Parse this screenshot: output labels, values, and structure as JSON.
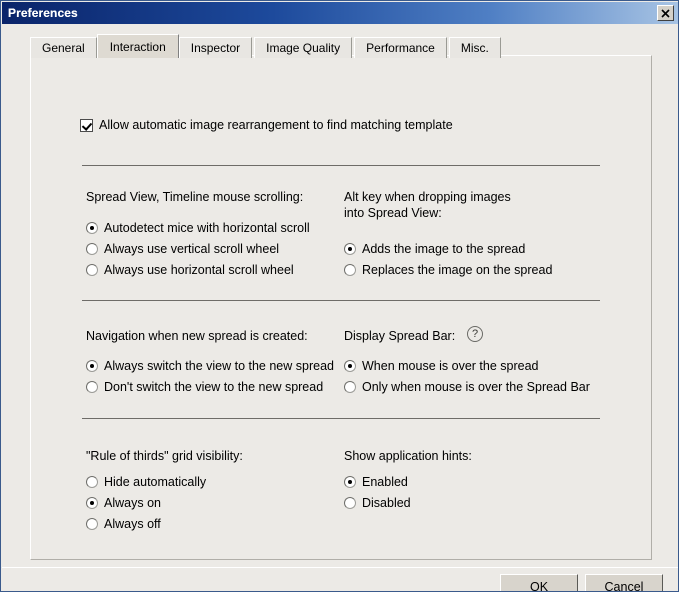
{
  "window": {
    "title": "Preferences",
    "close_label": "✖"
  },
  "tabs": [
    {
      "label": "General",
      "active": false
    },
    {
      "label": "Interaction",
      "active": true
    },
    {
      "label": "Inspector",
      "active": false
    },
    {
      "label": "Image Quality",
      "active": false
    },
    {
      "label": "Performance",
      "active": false
    },
    {
      "label": "Misc.",
      "active": false
    }
  ],
  "content": {
    "auto_rearrange": {
      "label": "Allow automatic image rearrangement to find matching template",
      "checked": true
    },
    "scroll_group": {
      "heading": "Spread View, Timeline mouse scrolling:",
      "options": [
        {
          "label": "Autodetect mice with horizontal scroll",
          "selected": true
        },
        {
          "label": "Always use vertical scroll wheel",
          "selected": false
        },
        {
          "label": "Always use horizontal scroll wheel",
          "selected": false
        }
      ]
    },
    "alt_key_group": {
      "heading": "Alt key when dropping images\ninto Spread View:",
      "options": [
        {
          "label": "Adds the image to the spread",
          "selected": true
        },
        {
          "label": "Replaces the image on the spread",
          "selected": false
        }
      ]
    },
    "navigation_group": {
      "heading": "Navigation when new spread is created:",
      "options": [
        {
          "label": "Always switch the view to the new spread",
          "selected": true
        },
        {
          "label": "Don't switch the view to the new spread",
          "selected": false
        }
      ]
    },
    "spread_bar_group": {
      "heading": "Display Spread Bar:",
      "help_icon": "?",
      "options": [
        {
          "label": "When mouse is over the spread",
          "selected": true
        },
        {
          "label": "Only when mouse is over the Spread Bar",
          "selected": false
        }
      ]
    },
    "rule_of_thirds_group": {
      "heading": "\"Rule of thirds\" grid visibility:",
      "options": [
        {
          "label": "Hide automatically",
          "selected": false
        },
        {
          "label": "Always on",
          "selected": true
        },
        {
          "label": "Always off",
          "selected": false
        }
      ]
    },
    "hints_group": {
      "heading": "Show application hints:",
      "options": [
        {
          "label": "Enabled",
          "selected": true
        },
        {
          "label": "Disabled",
          "selected": false
        }
      ]
    }
  },
  "footer": {
    "ok_label": "OK",
    "cancel_label": "Cancel"
  }
}
